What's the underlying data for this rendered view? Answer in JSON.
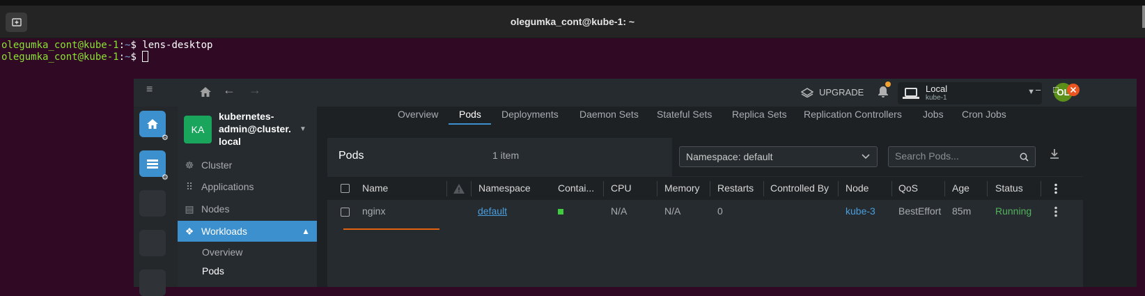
{
  "terminal": {
    "title": "olegumka_cont@kube-1: ~",
    "lines": [
      {
        "user": "olegumka_cont@kube-1",
        "sep": ":",
        "path": "~",
        "cmd": "$ lens-desktop"
      },
      {
        "user": "olegumka_cont@kube-1",
        "sep": ":",
        "path": "~",
        "cmd": "$ "
      }
    ]
  },
  "lens": {
    "topbar": {
      "upgrade_label": "UPGRADE",
      "cluster_name": "Local",
      "cluster_sub": "kube-1",
      "avatar_initials": "OL"
    },
    "sidebar": {
      "cluster_badge": "KA",
      "cluster_name": "kubernetes-admin@cluster.local",
      "cluster_name_lines": [
        "kubernetes-",
        "admin@cluster.",
        "local"
      ],
      "items": [
        {
          "label": "Cluster",
          "icon": "helm-icon"
        },
        {
          "label": "Applications",
          "icon": "grid-icon"
        },
        {
          "label": "Nodes",
          "icon": "server-icon"
        },
        {
          "label": "Workloads",
          "icon": "cubes-icon"
        }
      ],
      "subitems": [
        {
          "label": "Overview"
        },
        {
          "label": "Pods"
        }
      ]
    },
    "tabs": [
      "Overview",
      "Pods",
      "Deployments",
      "Daemon Sets",
      "Stateful Sets",
      "Replica Sets",
      "Replication Controllers",
      "Jobs",
      "Cron Jobs"
    ],
    "panel": {
      "title": "Pods",
      "count": "1 item",
      "namespace_select": "Namespace: default",
      "search_placeholder": "Search Pods..."
    },
    "table": {
      "headers": [
        "Name",
        "Namespace",
        "Contai...",
        "CPU",
        "Memory",
        "Restarts",
        "Controlled By",
        "Node",
        "QoS",
        "Age",
        "Status"
      ],
      "rows": [
        {
          "name": "nginx",
          "namespace": "default",
          "cpu": "N/A",
          "memory": "N/A",
          "restarts": "0",
          "controlled_by": "",
          "node": "kube-3",
          "qos": "BestEffort",
          "age": "85m",
          "status": "Running"
        }
      ]
    },
    "colors": {
      "accent": "#3d90ce",
      "running": "#52b35c",
      "container_ready": "#3fcc3f",
      "avatar": "#5b8f1a",
      "cluster_badge": "#1aa55c"
    }
  }
}
